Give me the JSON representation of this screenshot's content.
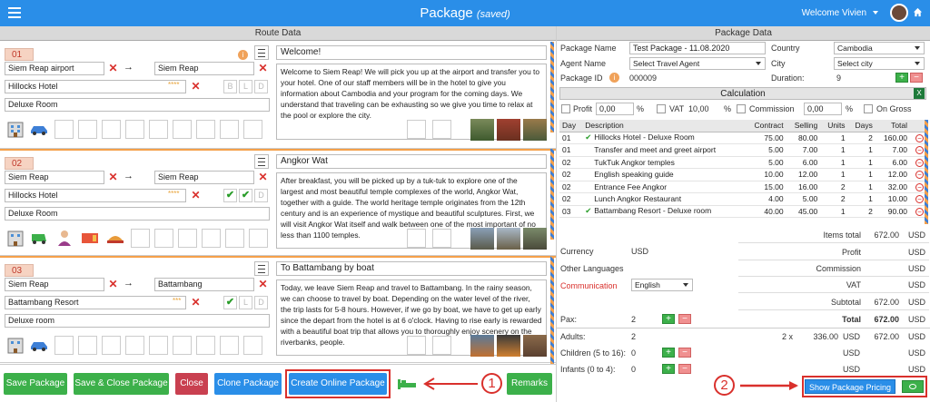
{
  "header": {
    "title": "Package",
    "status": "(saved)",
    "welcome": "Welcome Vivien"
  },
  "left": {
    "heading": "Route Data"
  },
  "days": [
    {
      "num": "01",
      "from": "Siem Reap airport",
      "to": "Siem Reap",
      "hotel": "Hillocks Hotel",
      "stars": "****",
      "room": "Deluxe Room",
      "title": "Welcome!",
      "desc": "Welcome to Siem Reap! We will pick you up at the airport and transfer you to your hotel. One of our staff members will be in the hotel to give you information about Cambodia and your program for the coming days. We understand that traveling can be exhausting so we give you time to relax at the pool or explore the city.",
      "meals": [
        "B",
        "L",
        "D"
      ]
    },
    {
      "num": "02",
      "from": "Siem Reap",
      "to": "Siem Reap",
      "hotel": "Hillocks Hotel",
      "stars": "****",
      "room": "Deluxe Room",
      "title": "Angkor Wat",
      "desc": "After breakfast, you will be picked up by a tuk-tuk to explore one of the largest and most beautiful temple complexes of the world, Angkor Wat, together with a guide. The world heritage temple originates from the 12th century and is an experience of mystique and beautiful sculptures. First, we will visit Angkor Wat itself and walk between one of the most important of no less than 1100 temples.",
      "meals": [
        "B",
        "L",
        "D"
      ]
    },
    {
      "num": "03",
      "from": "Siem Reap",
      "to": "Battambang",
      "hotel": "Battambang Resort",
      "stars": "***",
      "room": "Deluxe room",
      "title": "To Battambang by boat",
      "desc": "Today, we leave Siem Reap and travel to Battambang. In the rainy season, we can choose to travel by boat. Depending on the water level of the river, the trip lasts for 5-8 hours. However, if we go by boat, we have to get up early since the depart from the hotel is at 6 o'clock. Having to rise early is rewarded with a beautiful boat trip that allows you to thoroughly enjoy scenery on the riverbanks, people.",
      "meals": [
        "B",
        "L",
        "D"
      ]
    }
  ],
  "footer": {
    "save": "Save Package",
    "save_close": "Save & Close Package",
    "close": "Close",
    "clone": "Clone Package",
    "create": "Create Online Package",
    "remarks": "Remarks",
    "marker1": "1"
  },
  "right": {
    "heading": "Package Data",
    "package_name_label": "Package Name",
    "package_name": "Test Package - 11.08.2020",
    "agent_label": "Agent Name",
    "agent": "Select Travel Agent",
    "package_id_label": "Package ID",
    "package_id": "000009",
    "country_label": "Country",
    "country": "Cambodia",
    "city_label": "City",
    "city": "Select city",
    "duration_label": "Duration:",
    "duration": "9",
    "calc_heading": "Calculation",
    "profit_label": "Profit",
    "profit": "0,00",
    "vat_label": "VAT",
    "vat": "10,00",
    "commission_label": "Commission",
    "commission": "0,00",
    "on_gross": "On Gross",
    "pct": "%",
    "cols": [
      "Day",
      "Description",
      "Contract",
      "Selling",
      "Units",
      "Days",
      "Total"
    ],
    "items": [
      [
        "01",
        "✔",
        "Hillocks Hotel - Deluxe Room",
        "75.00",
        "80.00",
        "1",
        "2",
        "160.00"
      ],
      [
        "01",
        "",
        "Transfer and meet and greet airport",
        "5.00",
        "7.00",
        "1",
        "1",
        "7.00"
      ],
      [
        "02",
        "",
        "TukTuk Angkor temples",
        "5.00",
        "6.00",
        "1",
        "1",
        "6.00"
      ],
      [
        "02",
        "",
        "English speaking guide",
        "10.00",
        "12.00",
        "1",
        "1",
        "12.00"
      ],
      [
        "02",
        "",
        "Entrance Fee Angkor",
        "15.00",
        "16.00",
        "2",
        "1",
        "32.00"
      ],
      [
        "02",
        "",
        "Lunch Angkor Restaurant",
        "4.00",
        "5.00",
        "2",
        "1",
        "10.00"
      ],
      [
        "03",
        "✔",
        "Battambang Resort - Deluxe room",
        "40.00",
        "45.00",
        "1",
        "2",
        "90.00"
      ]
    ],
    "items_total_label": "Items total",
    "items_total": "672.00",
    "usd": "USD",
    "profit_row": "Profit",
    "commission_row": "Commission",
    "vat_row": "VAT",
    "subtotal_label": "Subtotal",
    "subtotal": "672.00",
    "total_label": "Total",
    "total": "672.00",
    "currency_label": "Currency",
    "currency": "USD",
    "other_lang_label": "Other Languages",
    "communication_label": "Communication",
    "communication": "English",
    "pax_label": "Pax:",
    "pax": "2",
    "adults_label": "Adults:",
    "adults": "2",
    "adults_mult": "2 x",
    "adults_price": "336.00",
    "adults_total": "672.00",
    "children_label": "Children (5 to 16):",
    "children": "0",
    "infants_label": "Infants (0 to 4):",
    "infants": "0",
    "show_pricing": "Show Package Pricing",
    "marker2": "2"
  }
}
